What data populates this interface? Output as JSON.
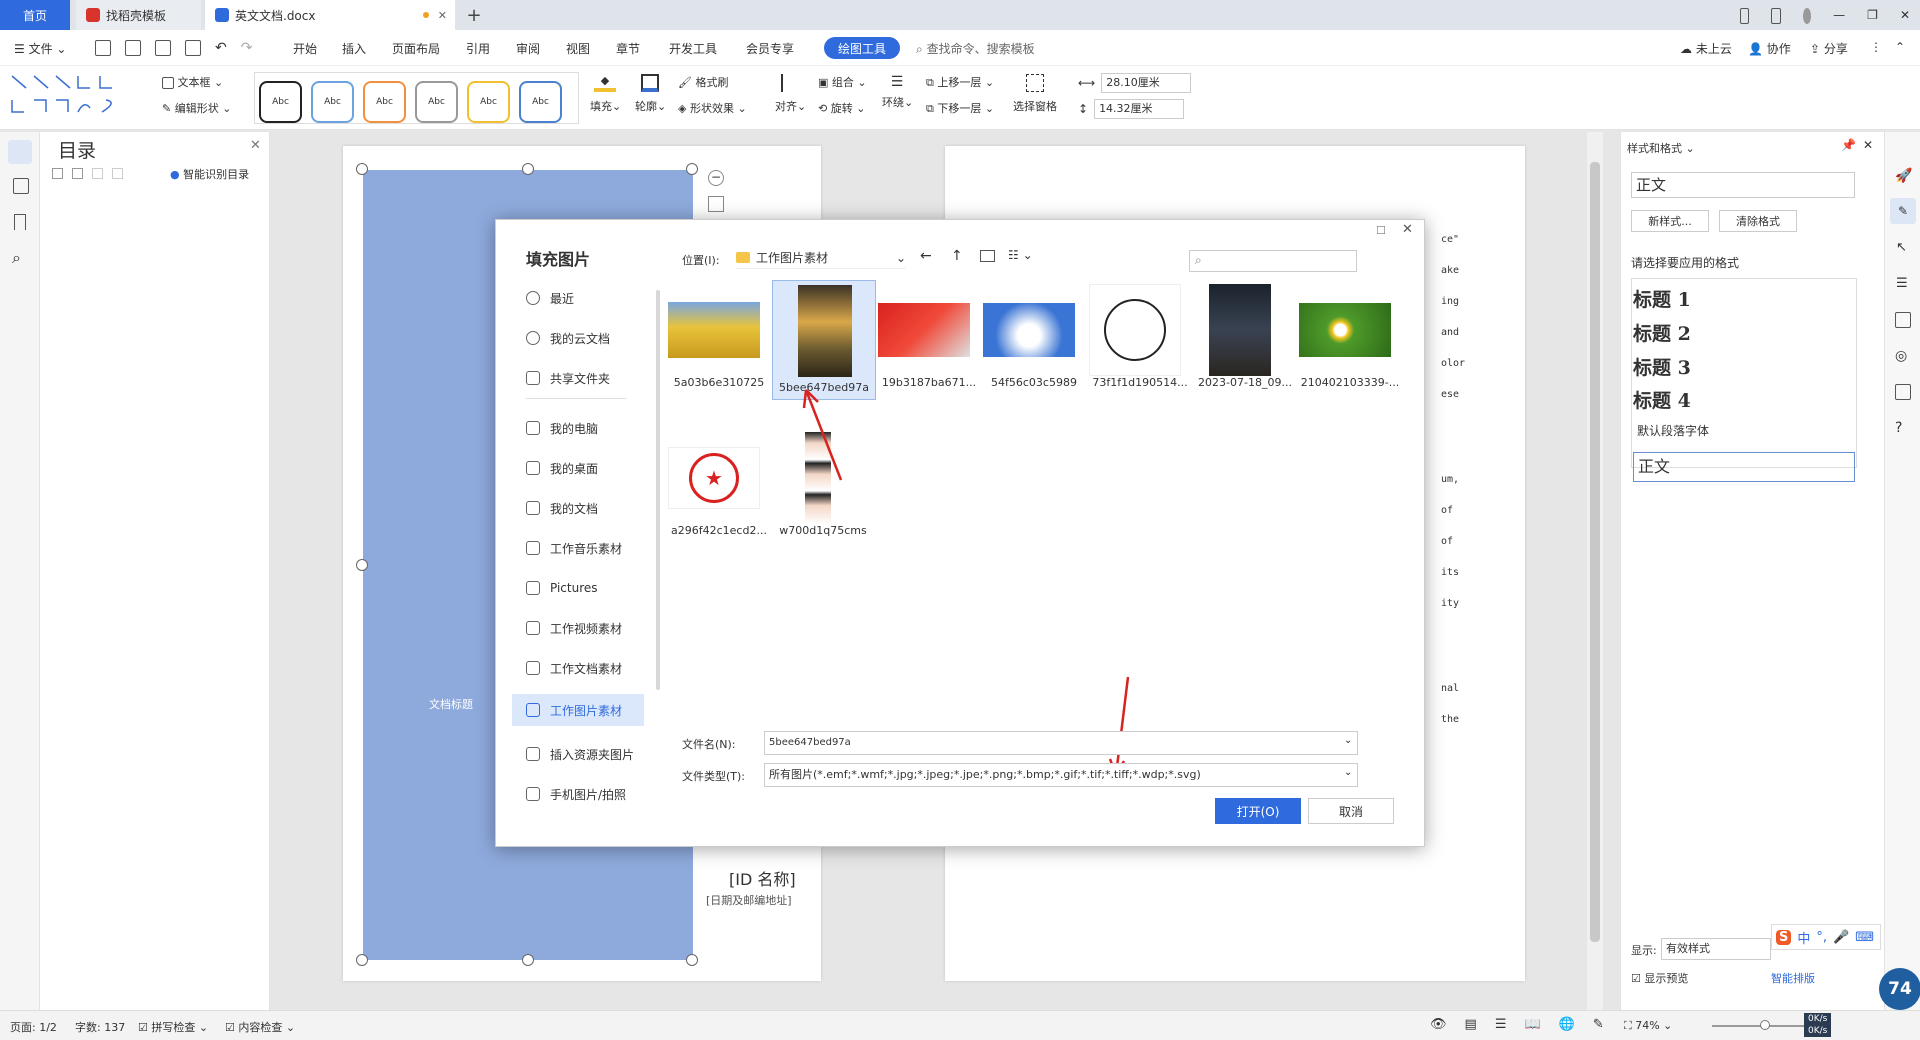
{
  "tabs": {
    "home": "首页",
    "template": "找稻壳模板",
    "doc": "英文文档.docx",
    "new": "+"
  },
  "menu": {
    "file": "文件",
    "items": [
      "开始",
      "插入",
      "页面布局",
      "引用",
      "审阅",
      "视图",
      "章节",
      "开发工具",
      "会员专享"
    ],
    "active": "绘图工具",
    "search": "查找命令、搜索模板",
    "cloud": "未上云",
    "collab": "协作",
    "share": "分享"
  },
  "ribbon": {
    "textbox": "文本框",
    "edit_shape": "编辑形状",
    "styles": [
      "Abc",
      "Abc",
      "Abc",
      "Abc",
      "Abc",
      "Abc"
    ],
    "fill": "填充",
    "outline": "轮廓",
    "format_brush": "格式刷",
    "shape_effect": "形状效果",
    "align": "对齐",
    "group": "组合",
    "rotate": "旋转",
    "wrap": "环绕",
    "bring_forward": "上移一层",
    "send_backward": "下移一层",
    "selection_pane": "选择窗格",
    "width": "28.10厘米",
    "height": "14.32厘米"
  },
  "toc": {
    "title": "目录",
    "smart": "智能识别目录"
  },
  "doc": {
    "title_placeholder": "文档标题",
    "id_name": "[ID 名称]",
    "date_email": "[日期及邮编地址]",
    "right_fragments": [
      "ce\"",
      "ake",
      "ing",
      "and",
      "olor",
      "ese",
      "um,",
      "of",
      "of",
      "its",
      "ity",
      "nal",
      "the"
    ]
  },
  "dialog": {
    "title": "填充图片",
    "location_label": "位置(I):",
    "location_value": "工作图片素材",
    "nav": [
      "最近",
      "我的云文档",
      "共享文件夹",
      "我的电脑",
      "我的桌面",
      "我的文档",
      "工作音乐素材",
      "Pictures",
      "工作视频素材",
      "工作文档素材",
      "工作图片素材",
      "插入资源夹图片",
      "手机图片/拍照"
    ],
    "files": [
      "5a03b6e310725",
      "5bee647bed97a",
      "19b3187ba671...",
      "54f56c03c5989",
      "73f1f1d190514...",
      "2023-07-18_09...",
      "210402103339-...",
      "a296f42c1ecd2...",
      "w700d1q75cms"
    ],
    "filename_label": "文件名(N):",
    "filename_value": "5bee647bed97a",
    "filetype_label": "文件类型(T):",
    "filetype_value": "所有图片(*.emf;*.wmf;*.jpg;*.jpeg;*.jpe;*.png;*.bmp;*.gif;*.tif;*.tiff;*.wdp;*.svg)",
    "open": "打开(O)",
    "cancel": "取消"
  },
  "styles_panel": {
    "title": "样式和格式",
    "current": "正文",
    "new_style": "新样式...",
    "clear": "清除格式",
    "choose": "请选择要应用的格式",
    "h1": "标题  1",
    "h2": "标题  2",
    "h3": "标题  3",
    "h4": "标题  4",
    "default_font": "默认段落字体",
    "body": "正文",
    "show_label": "显示:",
    "show_value": "有效样式",
    "preview": "显示预览",
    "smart_layout": "智能排版"
  },
  "status": {
    "page": "页面: 1/2",
    "words": "字数: 137",
    "spell": "拼写检查",
    "content": "内容检查",
    "zoom": "74%",
    "speed_up": "0K/s",
    "speed_down": "0K/s",
    "gauge": "74"
  },
  "colors": {
    "accent": "#2f6bdc",
    "shape_fill": "#8ea9dc"
  }
}
